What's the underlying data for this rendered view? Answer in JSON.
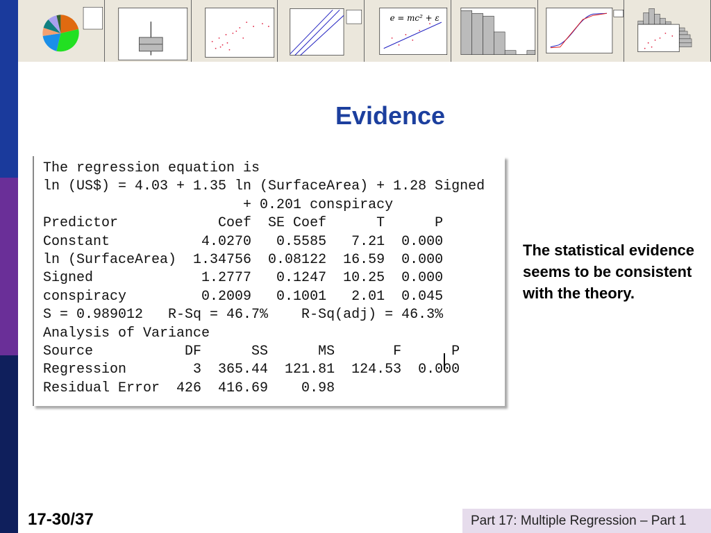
{
  "slide": {
    "title": "Evidence",
    "slide_number": "17-30/37",
    "footer": "Part 17: Multiple Regression – Part 1",
    "side_text": "The statistical evidence seems to be consistent with the theory."
  },
  "thumbnails": [
    "pie-chart",
    "boxplot",
    "scatterplot",
    "probability-plot",
    "scatterplot-with-fit",
    "histogram",
    "empirical-cdf",
    "marginal-plot"
  ],
  "thumbnail_equation": "e = mc² + ε",
  "output_lines": [
    "The regression equation is",
    "ln (US$) = 4.03 + 1.35 ln (SurfaceArea) + 1.28 Signed",
    "                        + 0.201 conspiracy",
    "Predictor            Coef  SE Coef      T      P",
    "Constant           4.0270   0.5585   7.21  0.000",
    "ln (SurfaceArea)  1.34756  0.08122  16.59  0.000",
    "Signed             1.2777   0.1247  10.25  0.000",
    "conspiracy         0.2009   0.1001   2.01  0.045",
    "S = 0.989012   R-Sq = 46.7%    R-Sq(adj) = 46.3%",
    "Analysis of Variance",
    "Source           DF      SS      MS       F      P",
    "Regression        3  365.44  121.81  124.53  0.000",
    "Residual Error  426  416.69    0.98"
  ],
  "colors": {
    "title": "#1c3f9e",
    "bar_top": "#1a3a9c",
    "bar_mid": "#6a2f98",
    "bar_bottom": "#0f1f5c",
    "footer_bg": "#e6dcec"
  }
}
